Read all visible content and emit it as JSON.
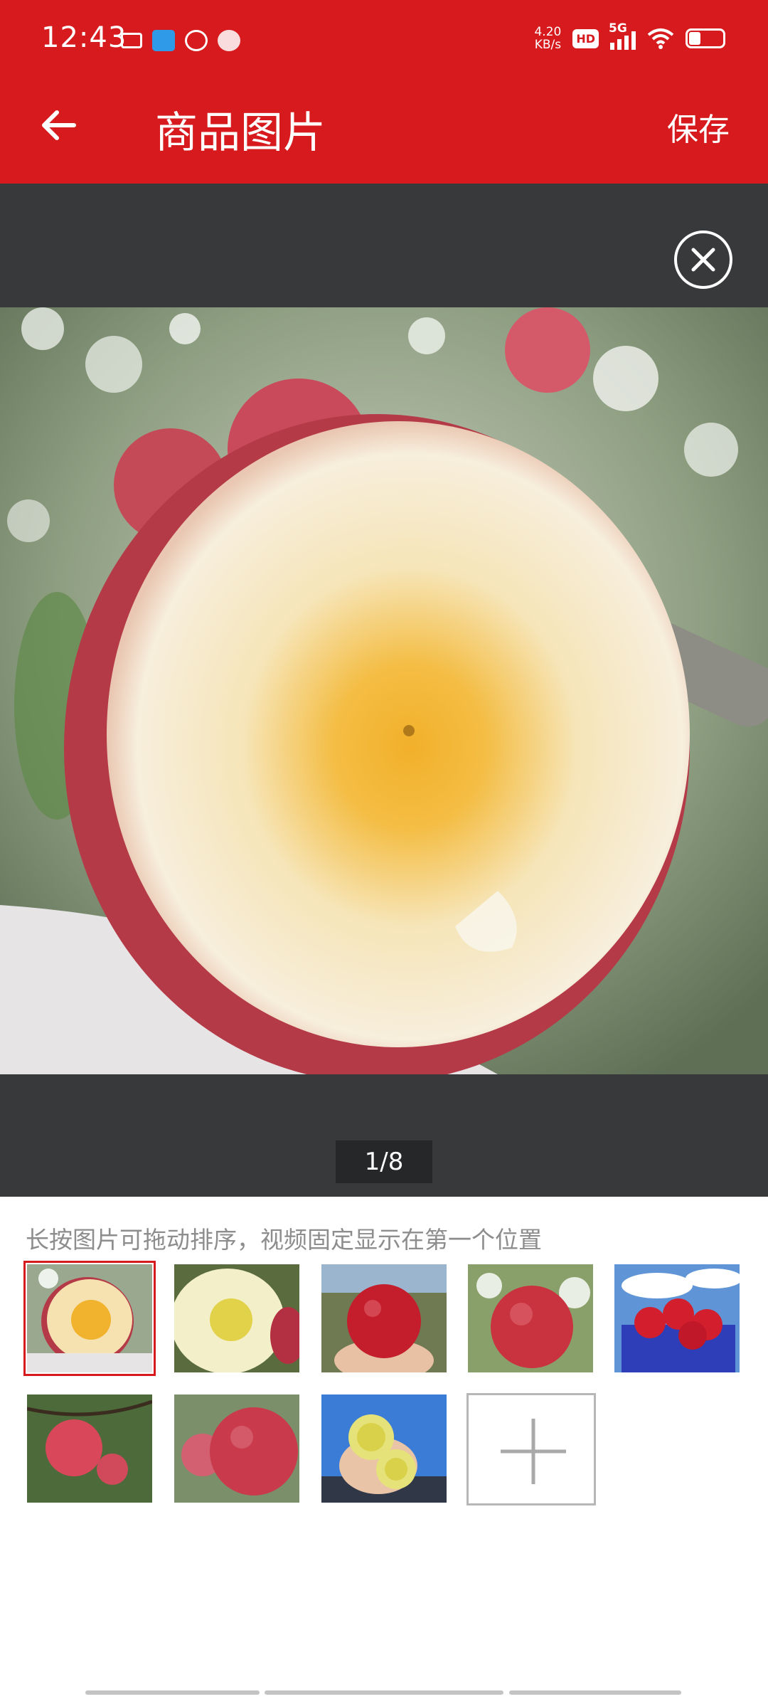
{
  "status_bar": {
    "time": "12:43",
    "net_speed_top": "4.20",
    "net_speed_bottom": "KB/s",
    "hd_label": "HD",
    "network": "5G"
  },
  "header": {
    "title": "商品图片",
    "save_label": "保存"
  },
  "preview": {
    "counter": "1/8",
    "current_index": 1,
    "total": 8
  },
  "gallery": {
    "hint": "长按图片可拖动排序，视频固定显示在第一个位置",
    "thumbnails": [
      {
        "name": "thumb-1-cut-apple",
        "selected": true
      },
      {
        "name": "thumb-2-cut-apple-yellow",
        "selected": false
      },
      {
        "name": "thumb-3-apple-in-hand",
        "selected": false
      },
      {
        "name": "thumb-4-apple-on-tree",
        "selected": false
      },
      {
        "name": "thumb-5-apples-in-basket",
        "selected": false
      },
      {
        "name": "thumb-6-apples-on-branch",
        "selected": false
      },
      {
        "name": "thumb-7-apples-closeup",
        "selected": false
      },
      {
        "name": "thumb-8-apple-slices-in-hand",
        "selected": false
      }
    ],
    "add_icon": "plus-icon"
  },
  "colors": {
    "brand_red": "#d71a1d",
    "preview_bg": "#38393b",
    "hint_gray": "#8d8d8d"
  }
}
